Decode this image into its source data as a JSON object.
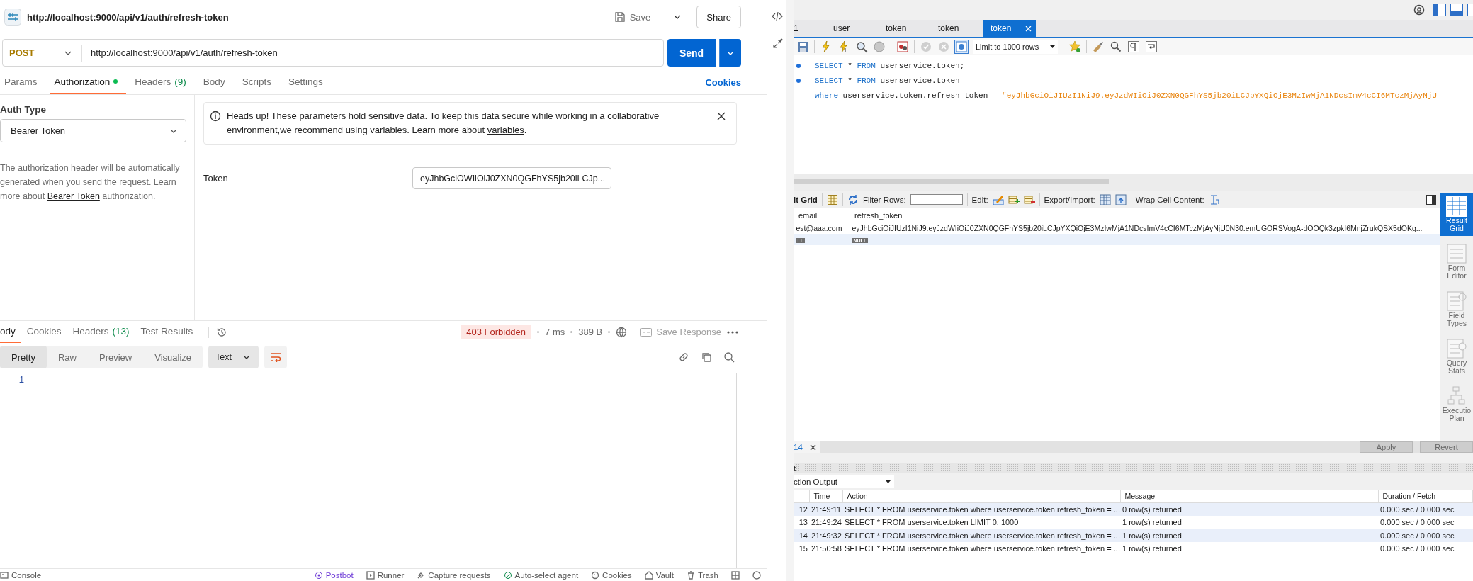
{
  "postman": {
    "request_title": "http://localhost:9000/api/v1/auth/refresh-token",
    "save_label": "Save",
    "share_label": "Share",
    "method": "POST",
    "url": "http://localhost:9000/api/v1/auth/refresh-token",
    "send_label": "Send",
    "request_tabs": [
      {
        "label": "Params",
        "selected": false,
        "indicator": false
      },
      {
        "label": "Authorization",
        "selected": true,
        "indicator": true
      },
      {
        "label": "Headers",
        "count": "(9)",
        "selected": false,
        "indicator": false
      },
      {
        "label": "Body",
        "selected": false,
        "indicator": false
      },
      {
        "label": "Scripts",
        "selected": false,
        "indicator": false
      },
      {
        "label": "Settings",
        "selected": false,
        "indicator": false
      }
    ],
    "cookies_link": "Cookies",
    "auth": {
      "label": "Auth Type",
      "type": "Bearer Token",
      "description_before": "The authorization header will be automatically generated when you send the request. Learn more about ",
      "description_link": "Bearer Token",
      "description_after": " authorization."
    },
    "alert": {
      "text_before": "Heads up! These parameters hold sensitive data. To keep this data secure while working in a collaborative environment,we recommend using variables. Learn more about ",
      "link": "variables",
      "text_after": "."
    },
    "token": {
      "label": "Token",
      "value": "eyJhbGciOWIiOiJ0ZXN0QGFhYS5jb20iLCJp..."
    },
    "response_tabs": [
      {
        "label": "ody",
        "selected": true
      },
      {
        "label": "Cookies",
        "selected": false
      },
      {
        "label": "Headers",
        "count": "(13)",
        "selected": false
      },
      {
        "label": "Test Results",
        "selected": false
      }
    ],
    "status": "403 Forbidden",
    "time": "7 ms",
    "size": "389 B",
    "save_response": "Save Response",
    "view_modes": [
      {
        "label": "Pretty",
        "selected": true
      },
      {
        "label": "Raw",
        "selected": false
      },
      {
        "label": "Preview",
        "selected": false
      },
      {
        "label": "Visualize",
        "selected": false
      }
    ],
    "format": "Text",
    "line_numbers": [
      "1"
    ],
    "footer": [
      {
        "label": "Console",
        "highlighted": false
      },
      {
        "label": "Postbot",
        "highlighted": true
      },
      {
        "label": "Runner",
        "highlighted": false
      },
      {
        "label": "Capture requests",
        "highlighted": false
      },
      {
        "label": "Auto-select agent",
        "highlighted": false
      },
      {
        "label": "Cookies",
        "highlighted": false
      },
      {
        "label": "Vault",
        "highlighted": false
      },
      {
        "label": "Trash",
        "highlighted": false
      }
    ]
  },
  "workbench": {
    "query_tabs": [
      {
        "label": "1",
        "selected": false
      },
      {
        "label": "user",
        "selected": false
      },
      {
        "label": "token",
        "selected": false
      },
      {
        "label": "token",
        "selected": false
      },
      {
        "label": "token",
        "selected": true
      }
    ],
    "limit": "Limit to 1000 rows",
    "sql_lines": [
      {
        "marker": true,
        "segments": [
          {
            "kind": "keyword",
            "text": "SELECT"
          },
          {
            "kind": "plain",
            "text": " * "
          },
          {
            "kind": "keyword",
            "text": "FROM"
          },
          {
            "kind": "plain",
            "text": " userservice.token;"
          }
        ]
      },
      {
        "marker": true,
        "segments": [
          {
            "kind": "keyword",
            "text": "SELECT"
          },
          {
            "kind": "plain",
            "text": " * "
          },
          {
            "kind": "keyword",
            "text": "FROM"
          },
          {
            "kind": "plain",
            "text": " userservice.token"
          }
        ]
      },
      {
        "marker": false,
        "segments": [
          {
            "kind": "keyword",
            "text": "where"
          },
          {
            "kind": "plain",
            "text": " userservice.token.refresh_token = "
          },
          {
            "kind": "string",
            "text": "\"eyJhbGciOiJIUzI1NiJ9.eyJzdWIiOiJ0ZXN0QGFhYS5jb20iLCJpYXQiOjE3MzIwMjA1NDcsImV4cCI6MTczMjAyNjU"
          }
        ]
      }
    ],
    "result_toolbar": {
      "title": "lt Grid",
      "filter_label": "Filter Rows:",
      "edit_label": "Edit:",
      "export_label": "Export/Import:",
      "wrap_label": "Wrap Cell Content:"
    },
    "grid_columns": [
      "email",
      "refresh_token"
    ],
    "grid_rows": [
      {
        "kind": "value",
        "cells": [
          "est@aaa.com",
          "eyJhbGciOiJIUzI1NiJ9.eyJzdWIiOiJ0ZXN0QGFhYS5jb20iLCJpYXQiOjE3MzIwMjA1NDcsImV4cCI6MTczMjAyNjU0N30.emUGORSVogA-dOOQk3zpkI6MnjZrukQSX5dOKg..."
        ]
      },
      {
        "kind": "null",
        "cells": [
          "LL",
          "NULL"
        ]
      }
    ],
    "side_panel": [
      {
        "label": "Result Grid",
        "selected": true
      },
      {
        "label": "Form Editor",
        "selected": false
      },
      {
        "label": "Field Types",
        "selected": false
      },
      {
        "label": "Query Stats",
        "selected": false
      },
      {
        "label": "Executio Plan",
        "selected": false
      }
    ],
    "result_tabs": [
      {
        "label": "14",
        "selected": true
      }
    ],
    "apply_label": "Apply",
    "revert_label": "Revert",
    "output_title": "t",
    "output_selector": "ction Output",
    "output_columns": [
      "Time",
      "Action",
      "Message",
      "Duration / Fetch"
    ],
    "output_rows": [
      {
        "number": "12",
        "time": "21:49:11",
        "action": "SELECT * FROM userservice.token  where userservice.token.refresh_token = ...",
        "message": "0 row(s) returned",
        "duration": "0.000 sec / 0.000 sec"
      },
      {
        "number": "13",
        "time": "21:49:24",
        "action": "SELECT * FROM userservice.token LIMIT 0, 1000",
        "message": "1 row(s) returned",
        "duration": "0.000 sec / 0.000 sec"
      },
      {
        "number": "14",
        "time": "21:49:32",
        "action": "SELECT * FROM userservice.token  where userservice.token.refresh_token = ...",
        "message": "1 row(s) returned",
        "duration": "0.000 sec / 0.000 sec"
      },
      {
        "number": "15",
        "time": "21:50:58",
        "action": "SELECT * FROM userservice.token  where userservice.token.refresh_token = ...",
        "message": "1 row(s) returned",
        "duration": "0.000 sec / 0.000 sec"
      }
    ]
  }
}
